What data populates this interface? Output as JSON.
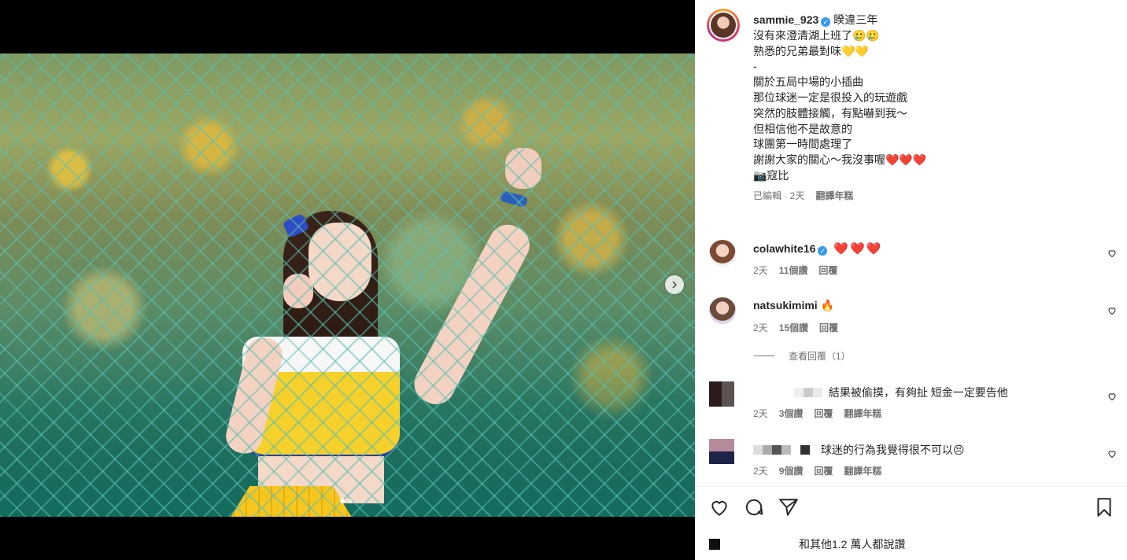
{
  "post": {
    "username": "sammie_923",
    "verified_mark": "✓",
    "tagline": "睽違三年",
    "caption_lines": [
      "沒有來澄清湖上班了🥲🥲",
      "熟悉的兄弟最對味💛💛",
      "-",
      "關於五局中場的小插曲",
      "那位球迷一定是很投入的玩遊戲",
      "突然的肢體接觸，有點嚇到我～",
      "但相信他不是故意的",
      "球團第一時間處理了",
      "謝謝大家的關心～我沒事喔❤️❤️❤️",
      "",
      "📷寇比"
    ],
    "edited": "已編輯 · 2天",
    "translate": "翻譯年糕",
    "likes_text": "和其他1.2 萬人都說讚"
  },
  "comments": [
    {
      "user": "colawhite16",
      "verified": true,
      "text": "❤️❤️❤️",
      "time": "2天",
      "likes": "11個讚",
      "reply": "回覆",
      "translate": ""
    },
    {
      "user": "natsukimimi",
      "verified": false,
      "text": "🔥",
      "time": "2天",
      "likes": "15個讚",
      "reply": "回覆",
      "translate": ""
    },
    {
      "user": "",
      "verified": false,
      "text": "結果被偷摸，有夠扯 短金一定要告他",
      "time": "2天",
      "likes": "3個讚",
      "reply": "回覆",
      "translate": "翻譯年糕"
    },
    {
      "user": "",
      "verified": false,
      "text": "球迷的行為我覺得很不可以😣",
      "time": "2天",
      "likes": "9個讚",
      "reply": "回覆",
      "translate": "翻譯年糕"
    }
  ],
  "view_replies": "查看回覆（1）",
  "icons": {
    "like": "heart-icon",
    "comment": "comment-icon",
    "share": "share-icon",
    "save": "bookmark-icon",
    "next": "chevron-right-icon"
  },
  "colors": {
    "verified": "#3897f0",
    "heart": "#e0245e",
    "muted": "#737373"
  }
}
